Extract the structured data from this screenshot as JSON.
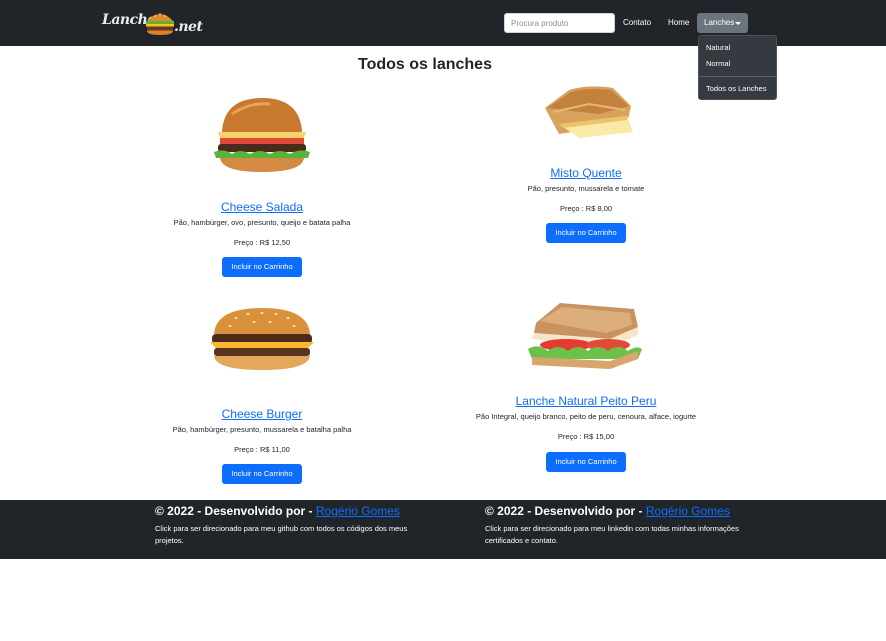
{
  "navbar": {
    "logo_text_left": "Lancho",
    "logo_text_right": ".net",
    "search_placeholder": "Procura produto",
    "links": {
      "contato": "Contato",
      "home": "Home"
    },
    "dropdown_label": "Lanches",
    "dropdown_items": [
      "Natural",
      "Normal",
      "Todos os Lanches"
    ]
  },
  "main": {
    "title": "Todos os lanches",
    "products": [
      {
        "name": "Cheese Salada",
        "description": "Pão, hambúrger, ovo, presunto, queijo e batata palha",
        "price": "Preço : R$ 12,50",
        "button": "Incluir no Carrinho",
        "image": "cheese-salada-burger"
      },
      {
        "name": "Misto Quente",
        "description": "Pão, presunto, mussarela e tomate",
        "price": "Preço : R$ 8,00",
        "button": "Incluir no Carrinho",
        "image": "grilled-ham-cheese-sandwich"
      },
      {
        "name": "Cheese Burger",
        "description": "Pão, hambúrger, presunto, mussarela e batalha palha",
        "price": "Preço : R$ 11,00",
        "button": "Incluir no Carrinho",
        "image": "cheeseburger"
      },
      {
        "name": "Lanche Natural Peito Peru",
        "description": "Pão Integral, queijo branco, peito de peru, cenoura, alface, iogurte",
        "price": "Preço : R$ 15,00",
        "button": "Incluir no Carrinho",
        "image": "natural-sandwich"
      }
    ]
  },
  "footer": {
    "columns": [
      {
        "prefix": "© 2022 - Desenvolvido por - ",
        "link": "Rogério Gomes",
        "text": "Click para ser direcionado para meu github com todos os códigos dos meus projetos."
      },
      {
        "prefix": "© 2022 - Desenvolvido por - ",
        "link": "Rogério Gomes",
        "text": "Click para ser direcionado para meu linkedin com todas minhas informações certificados e contato."
      }
    ]
  },
  "colors": {
    "navbar_bg": "#212529",
    "primary": "#0d6efd",
    "dropdown_bg": "#343a40",
    "active_tab": "#6c757d"
  }
}
